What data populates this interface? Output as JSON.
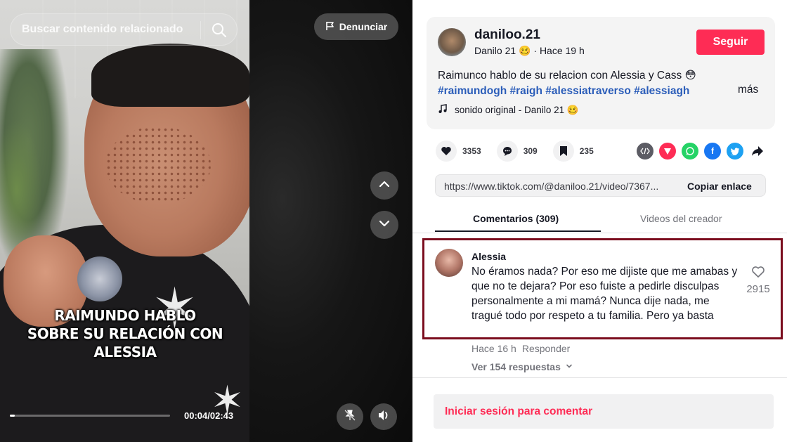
{
  "video": {
    "search_placeholder": "Buscar contenido relacionado",
    "report_label": "Denunciar",
    "caption": "RAIMUNDO HABLO\nSOBRE SU RELACIÓN CON\nALESSIA",
    "time": "00:04/02:43",
    "progress_fraction": 0.03
  },
  "author": {
    "username": "daniloo.21",
    "display_name": "Danilo 21 🥴",
    "posted": "Hace 19 h",
    "follow_label": "Seguir",
    "description": "Raimunco hablo de su relacion con Alessia y Cass 😳",
    "hashtags": "#raimundogh #raigh #alessiatraverso #alessiagh",
    "more_label": "más",
    "sound": "sonido original - Danilo 21 🥴"
  },
  "stats": {
    "likes": "3353",
    "comments": "309",
    "saves": "235"
  },
  "share": {
    "url": "https://www.tiktok.com/@daniloo.21/video/7367...",
    "copy_label": "Copiar enlace"
  },
  "tabs": {
    "comments": "Comentarios (309)",
    "creator_videos": "Videos del creador"
  },
  "comment": {
    "author": "Alessia",
    "text": "No éramos nada? Por eso me dijiste que me amabas y que no te dejara? Por eso fuiste a pedirle disculpas personalmente a mi mamá? Nunca dije nada, me tragué todo por respeto a tu familia. Pero ya basta",
    "likes": "2915",
    "time": "Hace 16 h",
    "reply_label": "Responder",
    "view_replies": "Ver 154 respuestas"
  },
  "login": {
    "label": "Iniciar sesión para comentar"
  },
  "colors": {
    "accent": "#fe2c55",
    "hashtag": "#2b5db9",
    "highlight_border": "#7b0d1e"
  }
}
